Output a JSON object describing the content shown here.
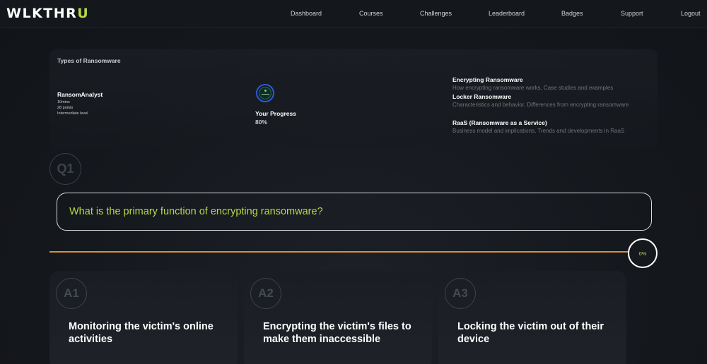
{
  "nav": {
    "logo_main": "WLKTHR",
    "logo_accent": "U",
    "links": [
      "Dashboard",
      "Courses",
      "Challenges",
      "Leaderboard",
      "Badges",
      "Support",
      "Logout"
    ]
  },
  "course": {
    "title": "Types of Ransomware",
    "author": "RansomAnalyst",
    "duration": "10mins",
    "points": "28 points",
    "level": "Intermediate level",
    "progress_label": "Your Progress",
    "progress_value": "80%",
    "topics": [
      {
        "title": "Encrypting Ransomware",
        "desc": "How encrypting ransomware works, Case studies and examples"
      },
      {
        "title": "Locker Ransomware",
        "desc": "Characteristics and behavior, Differences from encrypting ransomware"
      },
      {
        "title": "RaaS (Ransomware as a Service)",
        "desc": "Business model and implications, Trends and developments in RaaS"
      }
    ]
  },
  "quiz": {
    "question_number": "Q1",
    "question": "What is the primary function of encrypting ransomware?",
    "timer": "0%",
    "answers": [
      {
        "label": "A1",
        "text": "Monitoring the victim's online activities"
      },
      {
        "label": "A2",
        "text": "Encrypting the victim's files to make them inaccessible"
      },
      {
        "label": "A3",
        "text": "Locking the victim out of their device"
      }
    ]
  },
  "colors": {
    "accent_green": "#b6d84a",
    "timer_orange": "#d8922f",
    "background": "#15181d"
  }
}
